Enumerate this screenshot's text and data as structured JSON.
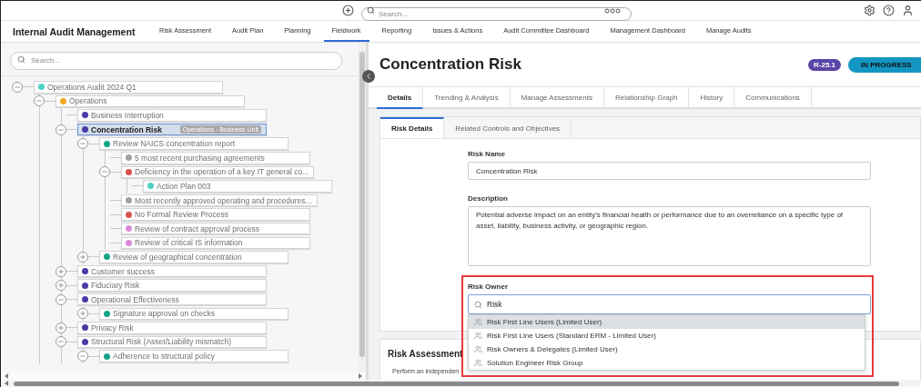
{
  "top_bar": {
    "search": {
      "placeholder": "Search..."
    }
  },
  "nav": {
    "app_title": "Internal Audit Management",
    "items": [
      {
        "label": "Risk Assessment",
        "selected": false
      },
      {
        "label": "Audit Plan",
        "selected": false
      },
      {
        "label": "Planning",
        "selected": false
      },
      {
        "label": "Fieldwork",
        "selected": true
      },
      {
        "label": "Reporting",
        "selected": false
      },
      {
        "label": "Issues & Actions",
        "selected": false
      },
      {
        "label": "Audit Committee Dashboard",
        "selected": false
      },
      {
        "label": "Management Dashboard",
        "selected": false
      },
      {
        "label": "Manage Audits",
        "selected": false
      }
    ]
  },
  "left_pane": {
    "search": {
      "placeholder": "Search..."
    },
    "tree": [
      {
        "label": "Operations Audit 2024 Q1",
        "color": "#4dd0c4",
        "selected": false,
        "expanded": true,
        "children": [
          {
            "label": "Operations",
            "color": "#f5a623",
            "selected": false,
            "expanded": true,
            "children": [
              {
                "label": "Business Interruption",
                "color": "#4a3aa6",
                "selected": false
              },
              {
                "label": "Concentration Risk",
                "color": "#4a3aa6",
                "selected": true,
                "tag": "Operations - Business Unit",
                "expanded": true,
                "children": [
                  {
                    "label": "Review NAICS concentration report",
                    "color": "#17a589",
                    "selected": false,
                    "expanded": true,
                    "children": [
                      {
                        "label": "5 most recent purchasing agreements",
                        "color": "#a0a0a0",
                        "selected": false
                      },
                      {
                        "label": "Deficiency in the operation of a key IT general co...",
                        "color": "#d9534f",
                        "selected": false,
                        "expanded": true,
                        "children": [
                          {
                            "label": "Action Plan 003",
                            "color": "#4dd0c4",
                            "selected": false
                          }
                        ]
                      },
                      {
                        "label": "Most recently approved operating and procedures...",
                        "color": "#a0a0a0",
                        "selected": false
                      },
                      {
                        "label": "No Formal Review Process",
                        "color": "#d9534f",
                        "selected": false
                      },
                      {
                        "label": "Review of contract approval process",
                        "color": "#d98ad9",
                        "selected": false
                      },
                      {
                        "label": "Review of critical IS information",
                        "color": "#d98ad9",
                        "selected": false
                      }
                    ]
                  },
                  {
                    "label": "Review of geographical concentration",
                    "color": "#17a589",
                    "selected": false,
                    "expanded": false
                  }
                ]
              },
              {
                "label": "Customer success",
                "color": "#4a3aa6",
                "selected": false,
                "expanded": false
              },
              {
                "label": "Fiduciary Risk",
                "color": "#4a3aa6",
                "selected": false,
                "expanded": false
              },
              {
                "label": "Operational Effectiveness",
                "color": "#4a3aa6",
                "selected": false,
                "expanded": true,
                "children": [
                  {
                    "label": "Signature approval on checks",
                    "color": "#17a589",
                    "selected": false,
                    "expanded": false
                  }
                ]
              },
              {
                "label": "Privacy Risk",
                "color": "#4a3aa6",
                "selected": false,
                "expanded": false
              },
              {
                "label": "Structural Risk (Asset/Liability mismatch)",
                "color": "#4a3aa6",
                "selected": false,
                "expanded": true,
                "children": [
                  {
                    "label": "Adherence to structural policy",
                    "color": "#17a589",
                    "selected": false,
                    "expanded": true
                  }
                ]
              }
            ]
          }
        ]
      }
    ]
  },
  "record": {
    "title": "Concentration Risk",
    "code": "R-25.1",
    "status": "IN PROGRESS",
    "tabs": [
      {
        "label": "Details",
        "selected": true
      },
      {
        "label": "Trending & Analysis",
        "selected": false
      },
      {
        "label": "Manage Assessments",
        "selected": false
      },
      {
        "label": "Relationship Graph",
        "selected": false
      },
      {
        "label": "History",
        "selected": false
      },
      {
        "label": "Communications",
        "selected": false
      }
    ],
    "subtabs": [
      {
        "label": "Risk Details",
        "selected": true
      },
      {
        "label": "Related Controls and Objectives",
        "selected": false
      }
    ],
    "risk_name": {
      "label": "Risk Name",
      "value": "Concentration Risk"
    },
    "description": {
      "label": "Description",
      "value": "Potential adverse impact on an entity's financial health or performance due to an overreliance on a specific type of asset, liability, business activity, or geographic region."
    },
    "risk_owner": {
      "label": "Risk Owner",
      "value": "Risk",
      "options": [
        {
          "label": "Risk First Line Users (Limited User)",
          "selected": true
        },
        {
          "label": "Risk First Line Users (Standard ERM - Limited User)",
          "selected": false
        },
        {
          "label": "Risk Owners & Delegates (Limited User)",
          "selected": false
        },
        {
          "label": "Solution Engineer Risk Group",
          "selected": false
        }
      ]
    },
    "assessment": {
      "title": "Risk Assessment",
      "text": "Perform an independen"
    }
  }
}
